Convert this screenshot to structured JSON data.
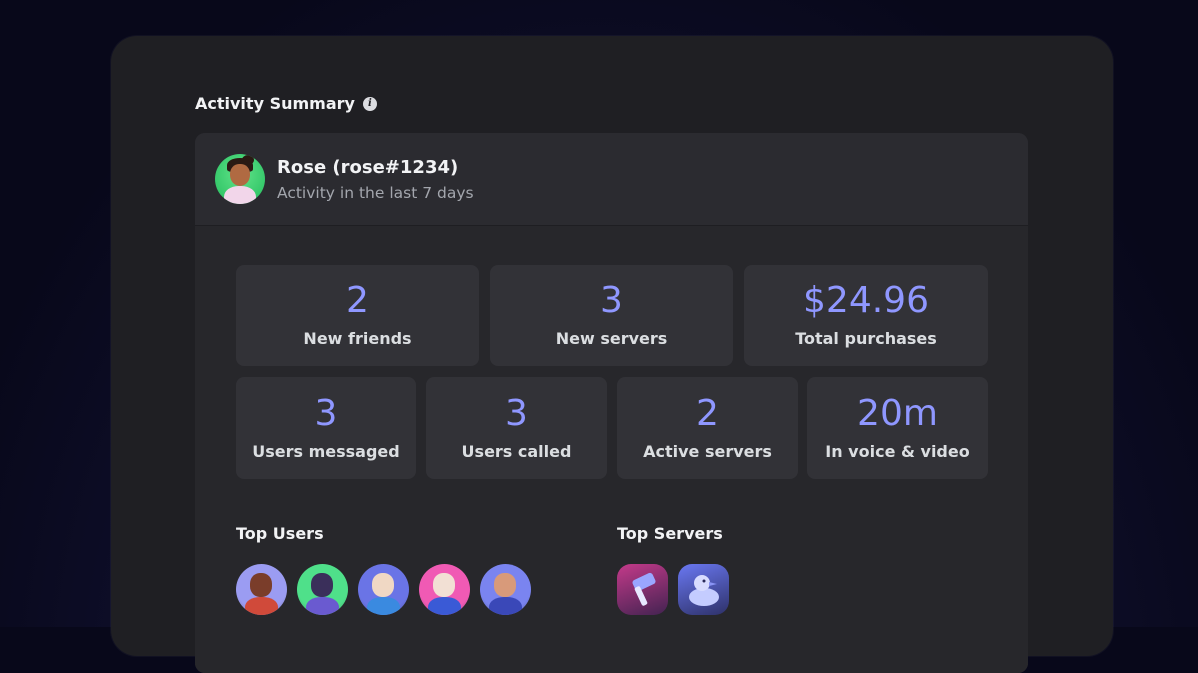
{
  "section": {
    "title": "Activity Summary",
    "info_icon": "info-icon"
  },
  "user": {
    "name": "Rose (rose#1234)",
    "subtitle": "Activity in the last 7 days",
    "avatar_icon": "user-avatar"
  },
  "stats_row1": [
    {
      "value": "2",
      "label": "New friends"
    },
    {
      "value": "3",
      "label": "New servers"
    },
    {
      "value": "$24.96",
      "label": "Total purchases"
    }
  ],
  "stats_row2": [
    {
      "value": "3",
      "label": "Users messaged"
    },
    {
      "value": "3",
      "label": "Users called"
    },
    {
      "value": "2",
      "label": "Active servers"
    },
    {
      "value": "20m",
      "label": "In voice & video"
    }
  ],
  "top_users": {
    "title": "Top Users",
    "avatars": [
      {
        "name": "top-user-1-avatar",
        "bg": "#9b9cf2",
        "skin": "#7a3d2a",
        "shirt": "#d04a3a"
      },
      {
        "name": "top-user-2-avatar",
        "bg": "#4fe08a",
        "skin": "#3a2f5a",
        "shirt": "#6a5ad0"
      },
      {
        "name": "top-user-3-avatar",
        "bg": "#6a74e6",
        "skin": "#f0d8c4",
        "shirt": "#3a8ae0"
      },
      {
        "name": "top-user-4-avatar",
        "bg": "#f05ab4",
        "skin": "#f2e0d4",
        "shirt": "#3a5ad6"
      },
      {
        "name": "top-user-5-avatar",
        "bg": "#7a84f0",
        "skin": "#d89a7a",
        "shirt": "#3a48b8"
      }
    ]
  },
  "top_servers": {
    "title": "Top Servers",
    "icons": [
      {
        "name": "top-server-hammer-icon",
        "bg": "#c43a8a"
      },
      {
        "name": "top-server-duck-icon",
        "bg": "#6a78f2"
      }
    ]
  },
  "colors": {
    "accent": "#8f97ff",
    "panel": "#1f1f23",
    "card": "#2b2b30",
    "tile": "#323237"
  }
}
